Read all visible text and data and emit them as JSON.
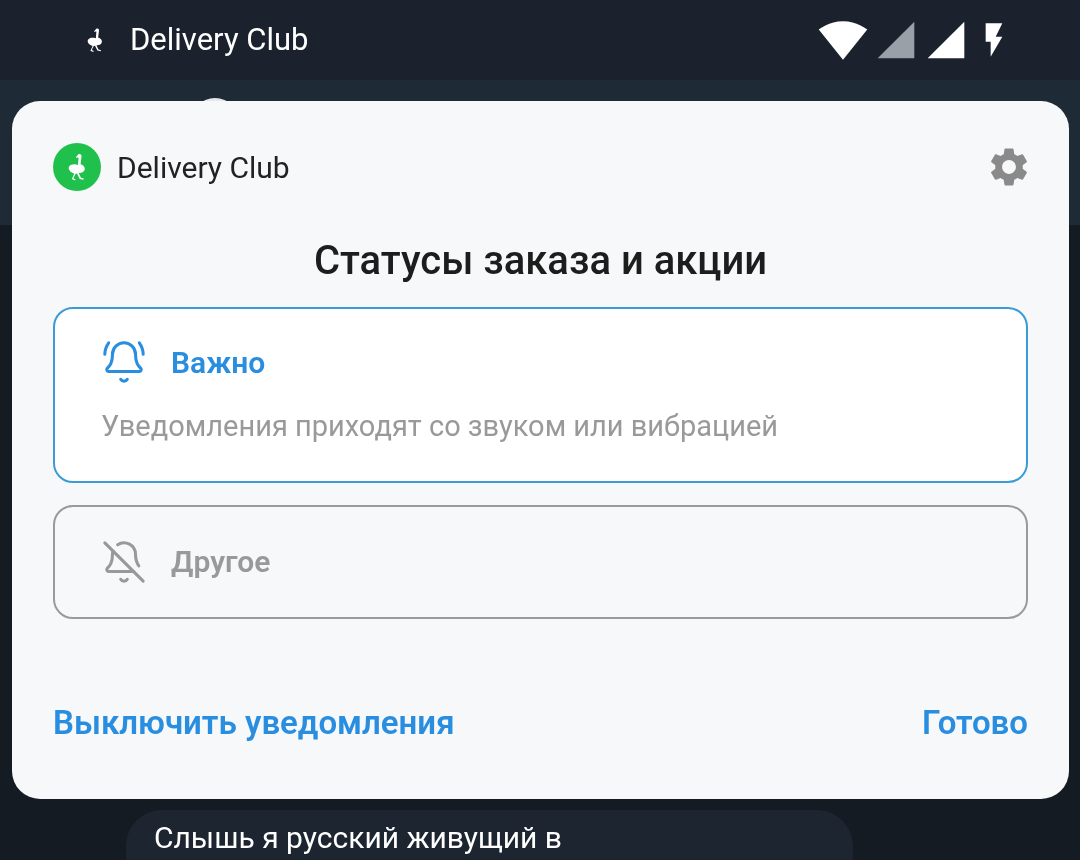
{
  "status_bar": {
    "app_name": "Delivery Club"
  },
  "notification_settings": {
    "app_name": "Delivery Club",
    "title": "Статусы заказа и акции",
    "channels": [
      {
        "kind": "important",
        "label": "Важно",
        "description": "Уведомления приходят со звуком или вибрацией",
        "selected": true
      },
      {
        "kind": "other",
        "label": "Другое",
        "selected": false
      }
    ],
    "actions": [
      "Выключить уведомления",
      "Готово"
    ]
  },
  "background_message": {
    "text": "Слышь я русский живущий в"
  }
}
